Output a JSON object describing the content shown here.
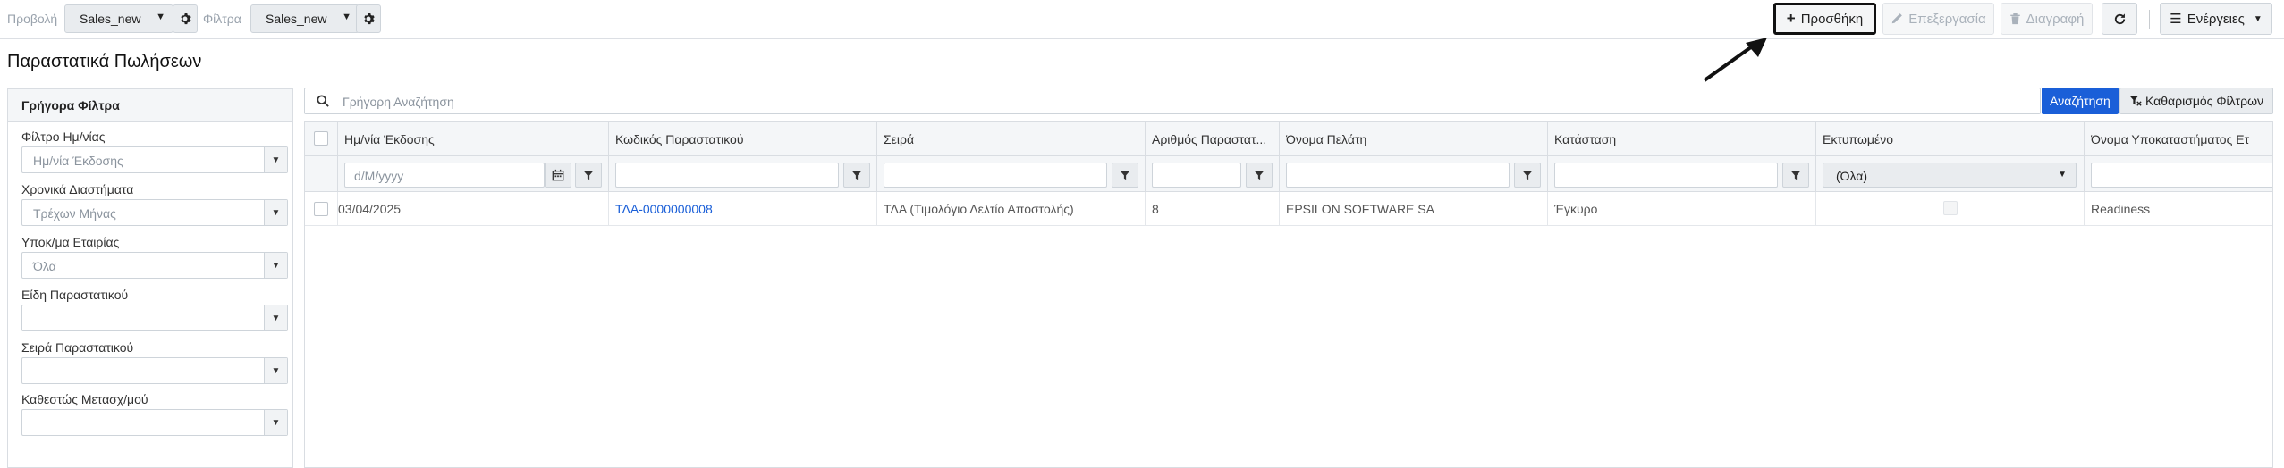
{
  "toolbar": {
    "view_label": "Προβολή",
    "view_value": "Sales_new",
    "filter_label": "Φίλτρα",
    "filter_value": "Sales_new",
    "add_label": "Προσθήκη",
    "edit_label": "Επεξεργασία",
    "delete_label": "Διαγραφή",
    "actions_label": "Ενέργειες"
  },
  "page": {
    "title": "Παραστατικά Πωλήσεων"
  },
  "sidebar": {
    "header": "Γρήγορα Φίλτρα",
    "filters": [
      {
        "label": "Φίλτρο Ημ/νίας",
        "value": "Ημ/νία Έκδοσης"
      },
      {
        "label": "Χρονικά Διαστήματα",
        "value": "Τρέχων Μήνας"
      },
      {
        "label": "Υποκ/μα Εταιρίας",
        "value": "Όλα"
      },
      {
        "label": "Είδη Παραστατικού",
        "value": ""
      },
      {
        "label": "Σειρά Παραστατικού",
        "value": ""
      },
      {
        "label": "Καθεστώς Μετασχ/μού",
        "value": ""
      }
    ]
  },
  "search": {
    "placeholder": "Γρήγορη Αναζήτηση",
    "search_label": "Αναζήτηση",
    "clear_label": "Καθαρισμός Φίλτρων"
  },
  "grid": {
    "columns": [
      "Ημ/νία Έκδοσης",
      "Κωδικός Παραστατικού",
      "Σειρά",
      "Αριθμός Παραστατ...",
      "Όνομα Πελάτη",
      "Κατάσταση",
      "Εκτυπωμένο",
      "Όνομα Υποκαταστήματος Ετ"
    ],
    "date_placeholder": "d/M/yyyy",
    "printed_filter_value": "(Όλα)",
    "rows": [
      {
        "date": "03/04/2025",
        "code": "ΤΔΑ-0000000008",
        "series": "ΤΔΑ (Τιμολόγιο Δελτίο Αποστολής)",
        "number": "8",
        "customer": "EPSILON SOFTWARE SA",
        "status": "Έγκυρο",
        "printed": false,
        "branch": "Readiness"
      }
    ]
  },
  "colors": {
    "accent": "#1a5fd8",
    "border": "#d9dde2",
    "header_bg": "#f4f6f8"
  }
}
